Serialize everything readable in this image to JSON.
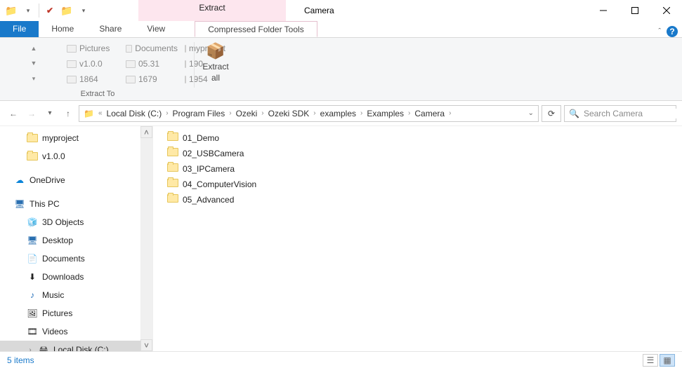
{
  "window": {
    "title": "Camera",
    "contextual_tab_title": "Extract"
  },
  "tabs": {
    "file": "File",
    "home": "Home",
    "share": "Share",
    "view": "View",
    "compressed": "Compressed Folder Tools"
  },
  "ribbon": {
    "destinations": [
      [
        "Pictures",
        "Documents",
        "myproject"
      ],
      [
        "v1.0.0",
        "05.31",
        "190"
      ],
      [
        "1864",
        "1679",
        "1954"
      ]
    ],
    "group_extract_to": "Extract To",
    "extract_all_line1": "Extract",
    "extract_all_line2": "all"
  },
  "breadcrumb": {
    "prefix": "«",
    "segments": [
      "Local Disk (C:)",
      "Program Files",
      "Ozeki",
      "Ozeki SDK",
      "examples",
      "Examples",
      "Camera"
    ]
  },
  "search": {
    "placeholder": "Search Camera"
  },
  "tree": {
    "pinned": [
      "myproject",
      "v1.0.0"
    ],
    "onedrive": "OneDrive",
    "thispc": "This PC",
    "thispc_children": [
      "3D Objects",
      "Desktop",
      "Documents",
      "Downloads",
      "Music",
      "Pictures",
      "Videos",
      "Local Disk (C:)"
    ]
  },
  "files": [
    "01_Demo",
    "02_USBCamera",
    "03_IPCamera",
    "04_ComputerVision",
    "05_Advanced"
  ],
  "status": {
    "count_label": "5 items"
  }
}
